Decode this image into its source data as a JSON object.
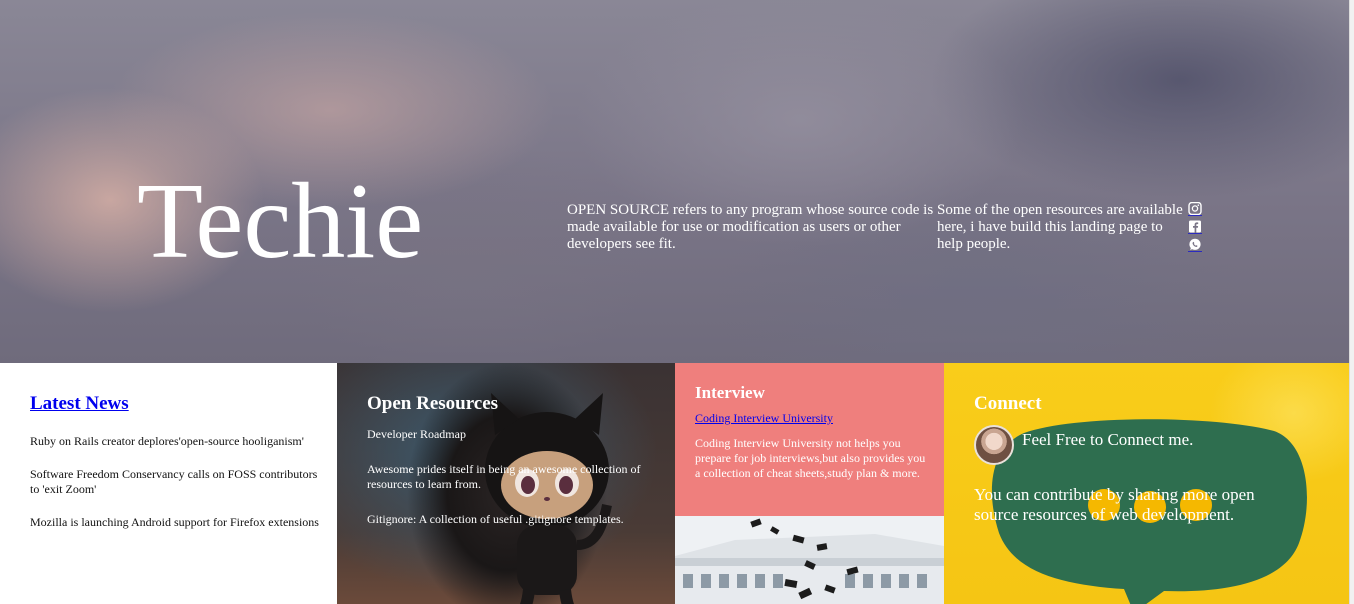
{
  "hero": {
    "title": "Techie",
    "description": "OPEN SOURCE refers to any program whose source code is made available for use or modification as users or other developers see fit.",
    "description2": "Some of the open resources are available here, i have build this landing page to help people.",
    "social_icons": [
      "instagram-icon",
      "facebook-icon",
      "whatsapp-icon"
    ]
  },
  "news": {
    "title": "Latest News",
    "items": [
      "Ruby on Rails creator deplores'open-source hooliganism'",
      "Software Freedom Conservancy calls on FOSS contributors to 'exit Zoom'",
      "Mozilla is launching Android support for Firefox extensions"
    ]
  },
  "resources": {
    "title": "Open Resources",
    "items": [
      "Developer Roadmap",
      "Awesome prides itself in being an awesome collection of resources to learn from.",
      "Gitignore: A collection of useful .gitignore templates."
    ]
  },
  "interview": {
    "title": "Interview",
    "link_text": "Coding Interview University",
    "description": "Coding Interview University not helps you prepare for job interviews,but also provides you a collection of cheat sheets,study plan & more."
  },
  "connect": {
    "title": "Connect",
    "feel_free": "Feel Free to Connect me.",
    "contribute": "You can contribute by sharing more open source resources of web development."
  },
  "colors": {
    "interview_bg": "#ef7f7d",
    "connect_bg": "#f9cd1a",
    "link": "#0000ee"
  }
}
